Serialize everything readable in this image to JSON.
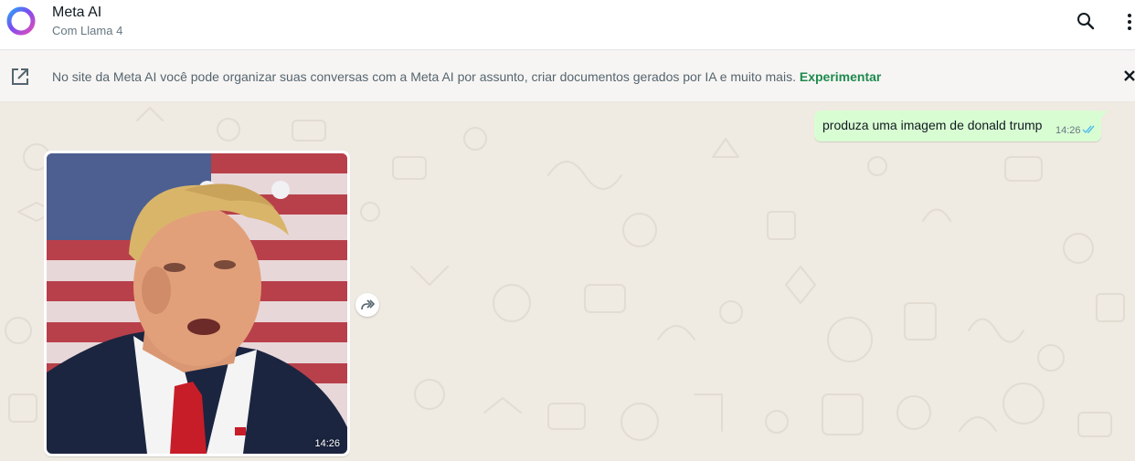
{
  "header": {
    "title": "Meta AI",
    "subtitle": "Com Llama 4",
    "icons": [
      "meta-ai-ring-icon",
      "search-icon",
      "kebab-menu-icon"
    ]
  },
  "banner": {
    "text": "No site da Meta AI você pode organizar suas conversas com a Meta AI por assunto, criar documentos gerados por IA e muito mais.",
    "link_label": "Experimentar",
    "icons": [
      "open-external-icon",
      "close-icon"
    ]
  },
  "messages": [
    {
      "direction": "outgoing",
      "text": "produza uma imagem de donald trump",
      "time": "14:26",
      "status": "read"
    },
    {
      "direction": "incoming",
      "type": "image",
      "time": "14:26"
    }
  ],
  "colors": {
    "accent_link": "#1d8a4e",
    "outgoing_bubble": "#d9fdd3",
    "read_ticks": "#53bdeb",
    "chat_background": "#efeae2"
  }
}
